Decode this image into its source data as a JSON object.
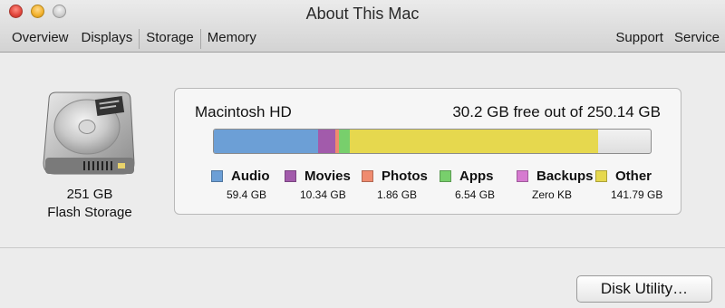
{
  "window": {
    "title": "About This Mac"
  },
  "tabs": [
    "Overview",
    "Displays",
    "Storage",
    "Memory"
  ],
  "tabs_right": [
    "Support",
    "Service"
  ],
  "active_tab": "Storage",
  "device": {
    "capacity": "251 GB",
    "type": "Flash Storage"
  },
  "volume": {
    "name": "Macintosh HD",
    "free_text": "30.2 GB free out of 250.14 GB"
  },
  "usage_bar": {
    "segments": [
      {
        "category": "Audio",
        "fraction": 0.238,
        "color": "#6c9fd6"
      },
      {
        "category": "Movies",
        "fraction": 0.041,
        "color": "#a25bab"
      },
      {
        "category": "Photos",
        "fraction": 0.007,
        "color": "#ef8b6f"
      },
      {
        "category": "Apps",
        "fraction": 0.026,
        "color": "#78cf6c"
      },
      {
        "category": "Backups",
        "fraction": 0.0,
        "color": "#d67ad0"
      },
      {
        "category": "Other",
        "fraction": 0.567,
        "color": "#e6d84e"
      },
      {
        "category": "Free",
        "fraction": 0.121,
        "color": ""
      }
    ]
  },
  "legend": [
    {
      "label": "Audio",
      "value": "59.4 GB",
      "color": "#6c9fd6"
    },
    {
      "label": "Movies",
      "value": "10.34 GB",
      "color": "#a25bab"
    },
    {
      "label": "Photos",
      "value": "1.86 GB",
      "color": "#ef8b6f"
    },
    {
      "label": "Apps",
      "value": "6.54 GB",
      "color": "#78cf6c"
    },
    {
      "label": "Backups",
      "value": "Zero KB",
      "color": "#d67ad0"
    },
    {
      "label": "Other",
      "value": "141.79 GB",
      "color": "#e6d84e"
    }
  ],
  "buttons": {
    "disk_utility": "Disk Utility…"
  }
}
